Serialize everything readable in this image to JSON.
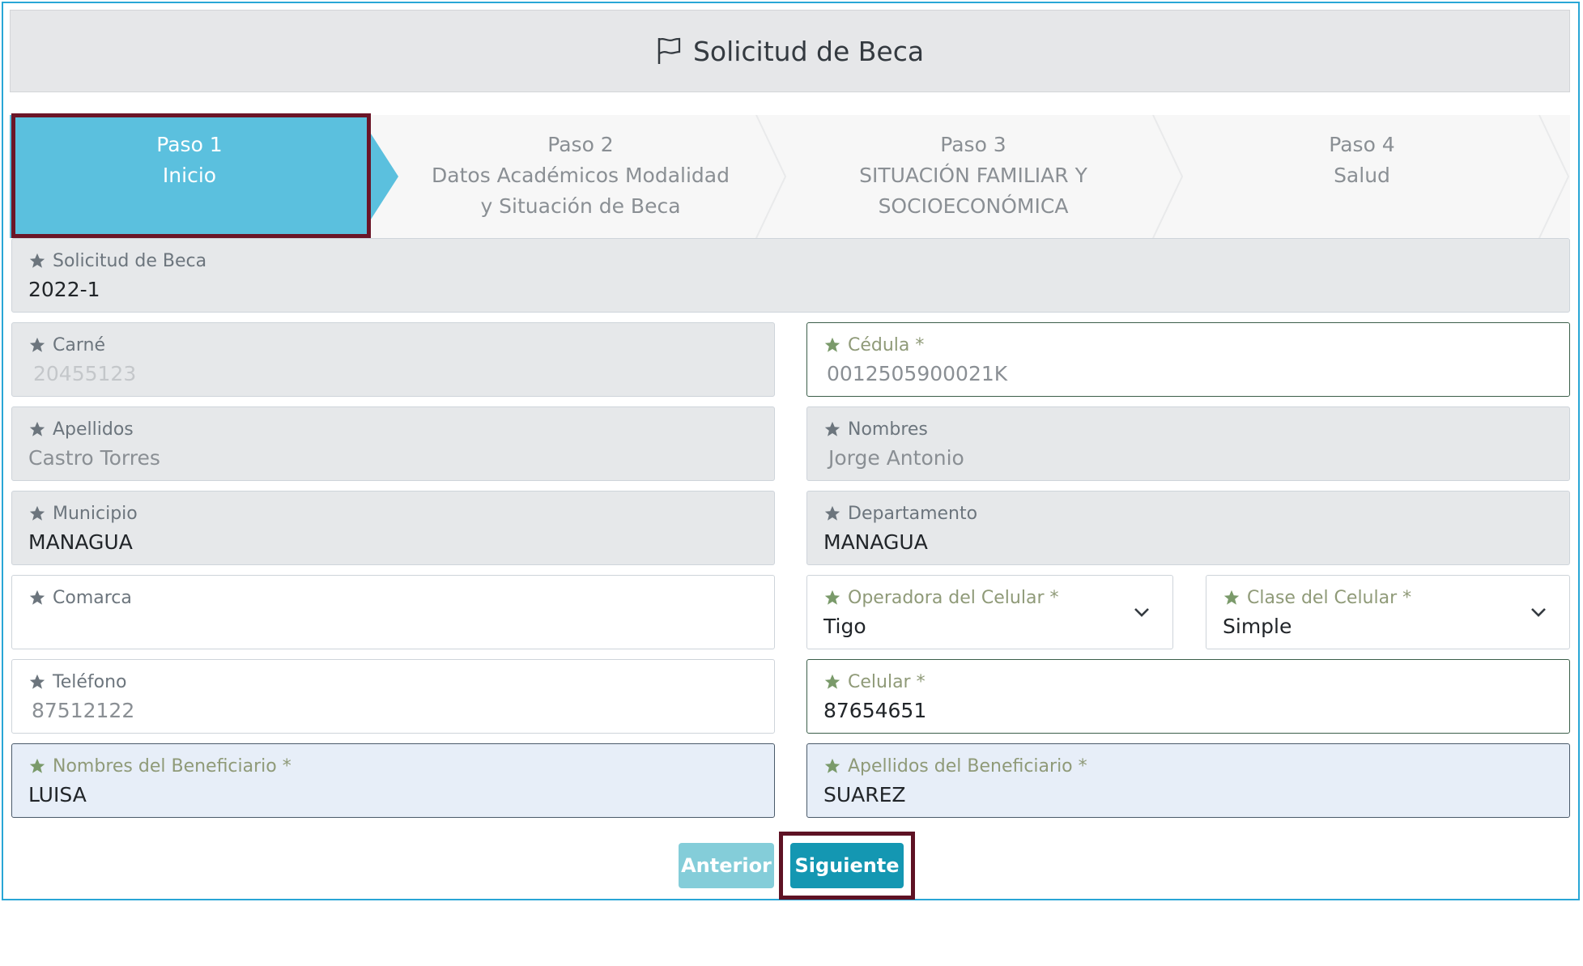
{
  "header": {
    "title": "Solicitud de Beca",
    "icon": "flag-icon"
  },
  "steps": [
    {
      "label": "Paso 1",
      "sub": "Inicio",
      "active": true
    },
    {
      "label": "Paso 2",
      "sub": "Datos Académicos Modalidad y Situación de Beca",
      "active": false
    },
    {
      "label": "Paso 3",
      "sub": "SITUACIÓN FAMILIAR Y SOCIOECONÓMICA",
      "active": false
    },
    {
      "label": "Paso 4",
      "sub": "Salud",
      "active": false
    }
  ],
  "form": {
    "solicitud": {
      "label": "Solicitud de Beca",
      "value": "2022-1"
    },
    "carne": {
      "label": "Carné",
      "value": "20455123"
    },
    "cedula": {
      "label": "Cédula *",
      "value": "0012505900021K"
    },
    "apellidos": {
      "label": "Apellidos",
      "value": "Castro Torres"
    },
    "nombres": {
      "label": "Nombres",
      "value": "Jorge Antonio"
    },
    "municipio": {
      "label": "Municipio",
      "value": "MANAGUA"
    },
    "departamento": {
      "label": "Departamento",
      "value": "MANAGUA"
    },
    "comarca": {
      "label": "Comarca",
      "value": ""
    },
    "operadora": {
      "label": "Operadora del Celular *",
      "value": "Tigo"
    },
    "clase": {
      "label": "Clase del Celular *",
      "value": "Simple"
    },
    "telefono": {
      "label": "Teléfono",
      "value": "87512122"
    },
    "celular": {
      "label": "Celular *",
      "value": "87654651"
    },
    "nombres_benef": {
      "label": "Nombres del Beneficiario *",
      "value": "LUISA"
    },
    "apellidos_benef": {
      "label": "Apellidos del Beneficiario *",
      "value": "SUAREZ"
    }
  },
  "buttons": {
    "prev": "Anterior",
    "next": "Siguiente"
  },
  "colors": {
    "active_step": "#5bc0de",
    "next_button": "#1497b2",
    "highlight": "#6b1527"
  }
}
